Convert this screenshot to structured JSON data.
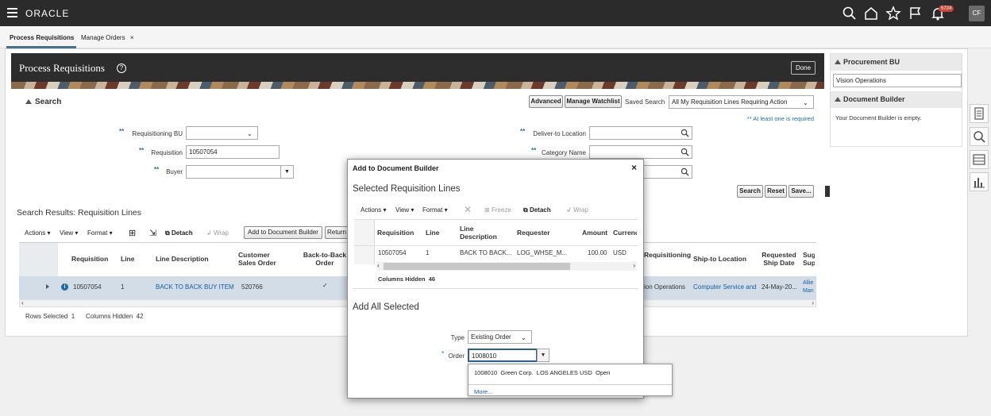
{
  "topbar": {
    "logo": "ORACLE",
    "notification_count": "5724",
    "user_initials": "CF"
  },
  "tabs": [
    {
      "label": "Process Requisitions"
    },
    {
      "label": "Manage Orders",
      "close": "×"
    }
  ],
  "page": {
    "title": "Process Requisitions",
    "help": "?",
    "done_label": "Done"
  },
  "search": {
    "header": "Search",
    "advanced_label": "Advanced",
    "watchlist_label": "Manage Watchlist",
    "saved_search_label": "Saved Search",
    "saved_search_value": "All My Requisition Lines Requiring Action",
    "at_least_one": "** At least one is required",
    "fields": {
      "req_bu_label": "Requisitioning BU",
      "req_bu_value": "",
      "requisition_label": "Requisition",
      "requisition_value": "10507054",
      "buyer_label": "Buyer",
      "buyer_value": "",
      "deliver_to_label": "Deliver-to Location",
      "category_label": "Category Name"
    },
    "required_marker": "**",
    "search_label": "Search",
    "reset_label": "Reset",
    "save_label": "Save..."
  },
  "results": {
    "header": "Search Results: Requisition Lines",
    "toolbar": {
      "actions": "Actions",
      "view": "View",
      "format": "Format",
      "detach": "Detach",
      "wrap": "Wrap",
      "add_to_doc_builder": "Add to Document Builder",
      "return": "Return"
    },
    "columns": [
      "Requisition",
      "Line",
      "Line Description",
      "Customer Sales Order",
      "Back-to-Back Order",
      "Requisitioning",
      "Ship-to Location",
      "Requested Ship Date",
      "Sug Sup"
    ],
    "row": {
      "requisition": "10507054",
      "line": "1",
      "description": "BACK TO BACK BUY ITEM",
      "customer_sales_order": "520766",
      "back_to_back": "✓",
      "requisitioning": "ion Operations",
      "ship_to": "Computer Service and",
      "requested_ship_date": "24-May-20...",
      "supplier": "Allie Man"
    },
    "rows_selected": "Rows Selected  1",
    "columns_hidden": "Columns Hidden  42"
  },
  "right_panel": {
    "procurement_bu_header": "Procurement BU",
    "procurement_bu_value": "Vision Operations",
    "doc_builder_header": "Document Builder",
    "doc_builder_text": "Your Document Builder is empty."
  },
  "dialog": {
    "title": "Add to Document Builder",
    "close": "×",
    "section1": "Selected Requisition Lines",
    "toolbar": {
      "actions": "Actions",
      "view": "View",
      "format": "Format",
      "freeze": "Freeze",
      "detach": "Detach",
      "wrap": "Wrap"
    },
    "columns": [
      "Requisition",
      "Line",
      "Line Description",
      "Requester",
      "Amount",
      "Currency"
    ],
    "row": {
      "requisition": "10507054",
      "line": "1",
      "description": "BACK TO BACK...",
      "requester": "LOG_WHSE_M...",
      "amount": "100.00",
      "currency": "USD"
    },
    "columns_hidden": "Columns Hidden  46",
    "section2": "Add All Selected",
    "type_label": "Type",
    "type_value": "Existing Order",
    "order_label": "Order",
    "order_required": "*",
    "order_value": "1008010",
    "dropdown_option": "1008010  Green Corp.  LOS ANGELES USD  Open",
    "dropdown_more": "More..."
  }
}
